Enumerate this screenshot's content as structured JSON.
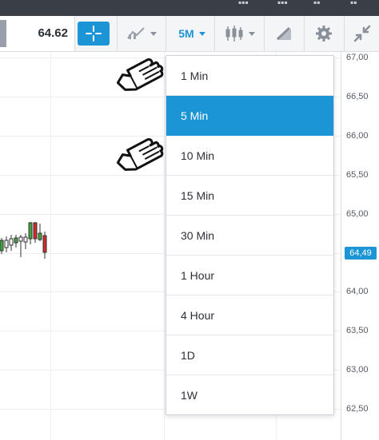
{
  "toolbar": {
    "price": "64.62",
    "crosshair_icon": "crosshair-icon",
    "chart_type_icon": "line-chart-icon",
    "interval_label": "5M",
    "candles_icon": "candlestick-icon",
    "drawing_icon": "drawing-pencil-icon",
    "settings_icon": "gear-icon",
    "collapse_icon": "collapse-arrows-icon"
  },
  "dropdown": {
    "items": [
      {
        "label": "1 Min"
      },
      {
        "label": "5 Min",
        "selected": true
      },
      {
        "label": "10 Min"
      },
      {
        "label": "15 Min"
      },
      {
        "label": "30 Min"
      },
      {
        "label": "1 Hour"
      },
      {
        "label": "4 Hour"
      },
      {
        "label": "1D"
      },
      {
        "label": "1W"
      }
    ]
  },
  "price_axis": {
    "ticks": [
      "67,00",
      "66,50",
      "66,00",
      "65,50",
      "65,00",
      "64,50",
      "64,00",
      "63,50",
      "63,00",
      "62,50"
    ],
    "current_price": "64,49"
  },
  "colors": {
    "accent": "#1b95d6",
    "candle_up": "#3fa63f",
    "candle_down": "#d62828"
  }
}
